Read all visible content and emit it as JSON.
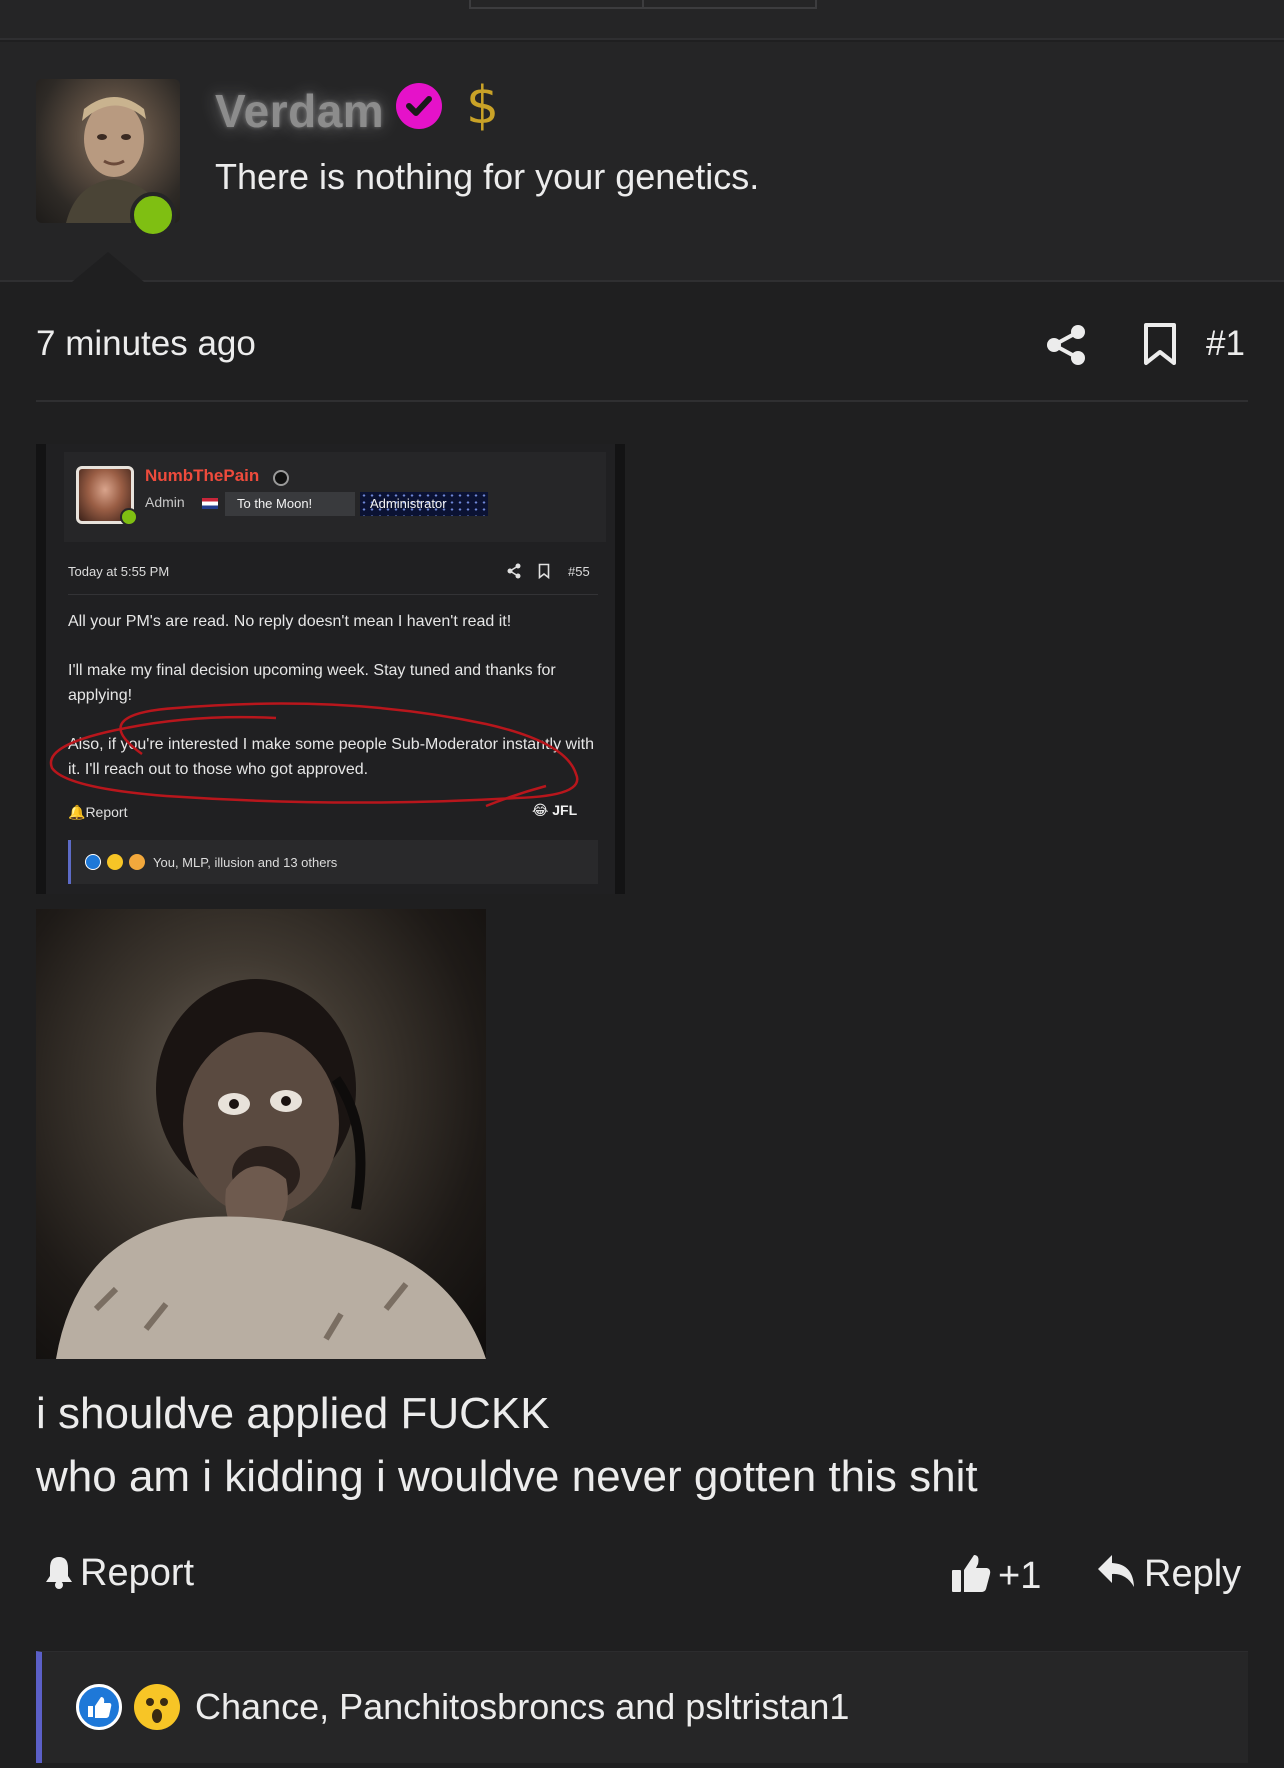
{
  "post": {
    "username": "Verdam",
    "tagline": "There is nothing for your genetics.",
    "dollar_symbol": "$",
    "timestamp": "7 minutes ago",
    "post_number": "#1",
    "caption_line1": "i shouldve applied FUCKK",
    "caption_line2": "who am i kidding i wouldve never gotten this shit"
  },
  "embedded_screenshot": {
    "username": "NumbThePain",
    "role": "Admin",
    "badge1": "To the Moon!",
    "badge2": "Administrator",
    "timestamp": "Today at 5:55 PM",
    "post_number": "#55",
    "paragraph1": "All your PM's are read. No reply doesn't mean I haven't read it!",
    "paragraph2": "I'll make my final decision upcoming week. Stay tuned and thanks for applying!",
    "paragraph3": "Also, if you're interested I make some people Sub-Moderator instantly with it. I'll reach out to those who got approved.",
    "report": "Report",
    "reaction_label": "JFL",
    "reactions_text": "You, MLP, illusion and 13 others"
  },
  "actions": {
    "report": "Report",
    "like_count": "+1",
    "reply": "Reply"
  },
  "reactions": {
    "text": "Chance, Panchitosbroncs and psltristan1"
  },
  "colors": {
    "background": "#1f1f20",
    "online": "#7fbf12",
    "verified": "#e512c9",
    "accent_bar": "#5b5fc7",
    "like_blue": "#1e78d8",
    "admin_name": "#ee4b3c"
  },
  "icons": {
    "share": "share-icon",
    "bookmark": "bookmark-icon",
    "report": "bell-icon",
    "like": "thumbs-up-icon",
    "reply": "reply-arrow-icon",
    "verified": "verified-check-icon",
    "dollar": "dollar-icon"
  }
}
